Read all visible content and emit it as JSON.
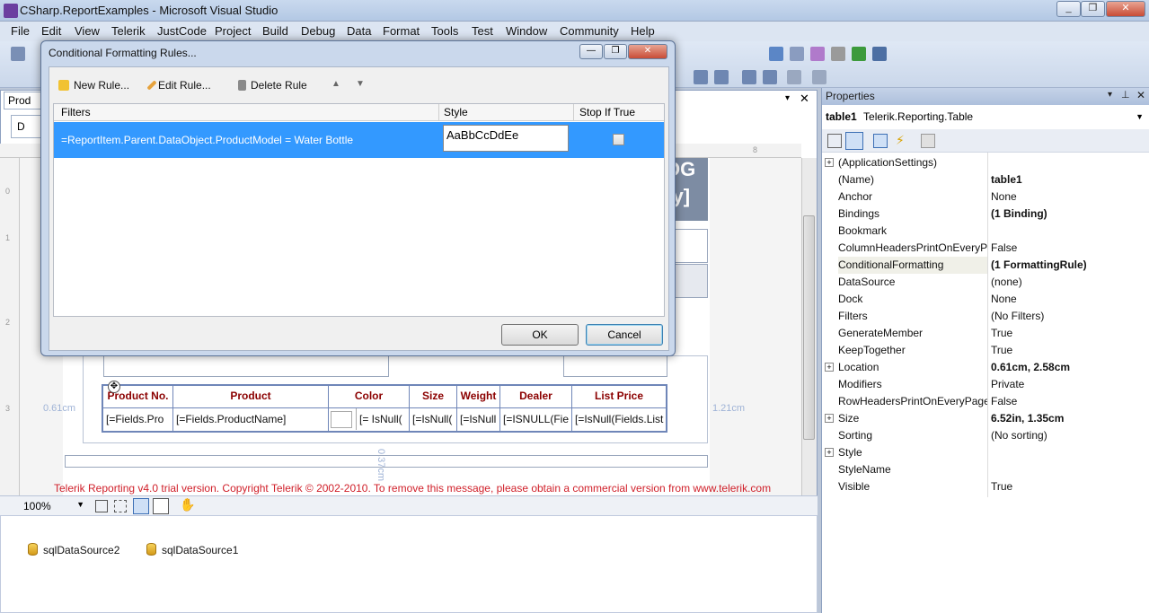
{
  "window": {
    "title": "CSharp.ReportExamples - Microsoft Visual Studio",
    "minimize": "_",
    "maximize": "❐",
    "close": "✕"
  },
  "menu": [
    "File",
    "Edit",
    "View",
    "Telerik",
    "JustCode",
    "Project",
    "Build",
    "Debug",
    "Data",
    "Format",
    "Tools",
    "Test",
    "Window",
    "Community",
    "Help"
  ],
  "designer": {
    "tab_label": "Prod",
    "tab2_label": "D",
    "pin": "▾",
    "close": "✕",
    "header_fragment_1": "OG",
    "header_fragment_2": "ry]",
    "ruler_top_mark": "8",
    "ruler_left_marks": [
      "0",
      "1",
      "2",
      "3"
    ],
    "left_dim": "0.61cm",
    "right_dim": "1.21cm",
    "bottom_dim": "0.37cm",
    "table": {
      "headers": [
        "Product No.",
        "Product",
        "Color",
        "Size",
        "Weight",
        "Dealer",
        "List Price"
      ],
      "cells": [
        "[=Fields.Pro",
        "[=Fields.ProductName]",
        "[= IsNull(",
        "[=IsNull(",
        "[=IsNull",
        "[=ISNULL(Fie",
        "[=IsNull(Fields.List"
      ]
    },
    "trial_message": "Telerik Reporting v4.0 trial version. Copyright Telerik © 2002-2010. To remove this message, please obtain a commercial version from www.telerik.com",
    "zoom": "100%"
  },
  "component_tray": [
    "sqlDataSource2",
    "sqlDataSource1"
  ],
  "properties": {
    "header": "Properties",
    "object_name": "table1",
    "object_type": "Telerik.Reporting.Table",
    "rows": [
      {
        "name": "(ApplicationSettings)",
        "value": "",
        "expandable": true,
        "bold": false
      },
      {
        "name": "(Name)",
        "value": "table1",
        "expandable": false,
        "bold": true
      },
      {
        "name": "Anchor",
        "value": "None",
        "expandable": false,
        "bold": false
      },
      {
        "name": "Bindings",
        "value": "(1 Binding)",
        "expandable": false,
        "bold": true
      },
      {
        "name": "Bookmark",
        "value": "",
        "expandable": false,
        "bold": false
      },
      {
        "name": "ColumnHeadersPrintOnEveryPa",
        "value": "False",
        "expandable": false,
        "bold": false
      },
      {
        "name": "ConditionalFormatting",
        "value": "(1 FormattingRule)",
        "expandable": false,
        "bold": true,
        "selected": true
      },
      {
        "name": "DataSource",
        "value": "(none)",
        "expandable": false,
        "bold": false
      },
      {
        "name": "Dock",
        "value": "None",
        "expandable": false,
        "bold": false
      },
      {
        "name": "Filters",
        "value": "(No Filters)",
        "expandable": false,
        "bold": false
      },
      {
        "name": "GenerateMember",
        "value": "True",
        "expandable": false,
        "bold": false
      },
      {
        "name": "KeepTogether",
        "value": "True",
        "expandable": false,
        "bold": false
      },
      {
        "name": "Location",
        "value": "0.61cm, 2.58cm",
        "expandable": true,
        "bold": true
      },
      {
        "name": "Modifiers",
        "value": "Private",
        "expandable": false,
        "bold": false
      },
      {
        "name": "RowHeadersPrintOnEveryPage",
        "value": "False",
        "expandable": false,
        "bold": false
      },
      {
        "name": "Size",
        "value": "6.52in, 1.35cm",
        "expandable": true,
        "bold": true
      },
      {
        "name": "Sorting",
        "value": "(No sorting)",
        "expandable": false,
        "bold": false
      },
      {
        "name": "Style",
        "value": "",
        "expandable": true,
        "bold": false
      },
      {
        "name": "StyleName",
        "value": "",
        "expandable": false,
        "bold": false
      },
      {
        "name": "Visible",
        "value": "True",
        "expandable": false,
        "bold": false
      }
    ]
  },
  "dialog": {
    "title": "Conditional Formatting Rules...",
    "toolbar": {
      "new_rule": "New Rule...",
      "edit_rule": "Edit Rule...",
      "delete_rule": "Delete Rule",
      "move_up": "▲",
      "move_down": "▼"
    },
    "columns": [
      "Filters",
      "Style",
      "Stop If True"
    ],
    "rule": {
      "filter": "=ReportItem.Parent.DataObject.ProductModel = Water Bottle",
      "style_preview": "AaBbCcDdEe",
      "stop_if_true": false
    },
    "ok": "OK",
    "cancel": "Cancel"
  },
  "colors": {
    "selection": "#3399ff",
    "table_border": "#6f86b8",
    "header_text": "#8b0000",
    "trial_text": "#d0202a"
  }
}
